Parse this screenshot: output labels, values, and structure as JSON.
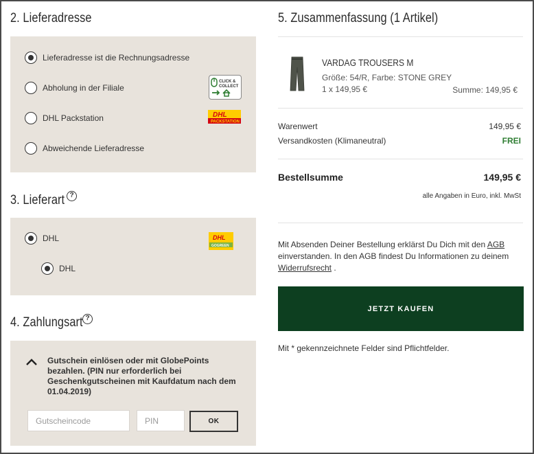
{
  "delivery_address": {
    "title": "2. Lieferadresse",
    "options": [
      {
        "label": "Lieferadresse ist die Rechnungsadresse",
        "checked": true
      },
      {
        "label": "Abholung in der Filiale",
        "checked": false,
        "badge": "CLICK & COLLECT"
      },
      {
        "label": "DHL Packstation",
        "checked": false,
        "badge": "DHL PACKSTATION"
      },
      {
        "label": "Abweichende Lieferadresse",
        "checked": false
      }
    ]
  },
  "delivery_method": {
    "title": "3. Lieferart",
    "help": "?",
    "carrier": {
      "label": "DHL",
      "checked": true
    },
    "service": {
      "label": "DHL",
      "checked": true
    }
  },
  "payment": {
    "title": "4. Zahlungsart",
    "help": "?",
    "coupon_text": "Gutschein einlösen oder mit GlobePoints bezahlen. (PIN nur erforderlich bei Geschenkgutscheinen mit Kaufdatum nach dem 01.04.2019)",
    "coupon_placeholder": "Gutscheincode",
    "pin_placeholder": "PIN",
    "ok_label": "OK"
  },
  "summary": {
    "title": "5. Zusammenfassung (1 Artikel)",
    "product": {
      "name": "VARDAG TROUSERS M",
      "details": "Größe: 54/R, Farbe: STONE GREY",
      "qty_price": "1 x 149,95 €",
      "sum": "Summe: 149,95 €"
    },
    "goods_label": "Warenwert",
    "goods_value": "149,95 €",
    "shipping_label": "Versandkosten (Klimaneutral)",
    "shipping_value": "FREI",
    "total_label": "Bestellsumme",
    "total_value": "149,95 €",
    "tax_note": "alle Angaben in Euro, inkl. MwSt",
    "legal_1": "Mit Absenden Deiner Bestellung erklärst Du Dich mit den",
    "legal_agb": "AGB",
    "legal_2": "einverstanden. In den AGB findest Du Informationen zu deinem",
    "legal_link": "Widerrufsrecht",
    "legal_3": ".",
    "buy_label": "JETZT KAUFEN",
    "required_note": "Mit * gekennzeichnete Felder sind Pflichtfelder."
  },
  "colors": {
    "panel": "#e8e3dc",
    "buy_button": "#0d3f20",
    "free_text": "#2e7d32",
    "dhl_yellow": "#ffcc00",
    "dhl_red": "#d40511"
  }
}
